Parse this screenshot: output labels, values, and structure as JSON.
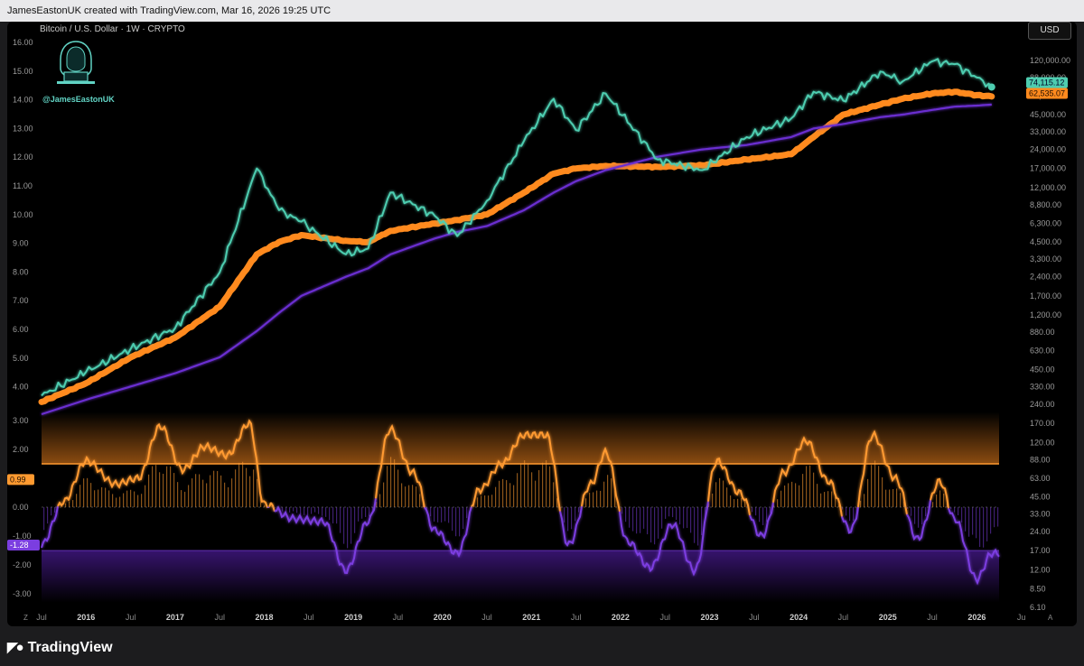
{
  "header": {
    "credit": "JamesEastonUK created with TradingView.com, Mar 16, 2026 19:25 UTC",
    "symbol": "Bitcoin / U.S. Dollar · 1W · CRYPTO",
    "handle": "@JamesEastonUK",
    "currency_button": "USD"
  },
  "footer": {
    "brand": "TradingView",
    "left_label": "Z",
    "right_label": "A"
  },
  "colors": {
    "price": "#4ecdb0",
    "orange_band": "#ff8a1e",
    "purple_ma": "#6a2ed0",
    "osc_positive": "#ff9a30",
    "osc_negative": "#7b3ee0"
  },
  "chart_data": [
    {
      "type": "line",
      "title": "Bitcoin / U.S. Dollar · 1W · CRYPTO",
      "y_scale": "log",
      "left_axis_ticks": [
        "16.00",
        "15.00",
        "14.00",
        "13.00",
        "12.00",
        "11.00",
        "10.00",
        "9.00",
        "8.00",
        "7.00",
        "6.00",
        "5.00",
        "4.00"
      ],
      "right_axis_ticks": [
        "120,000.00",
        "88,000.00",
        "63,000.00",
        "45,000.00",
        "33,000.00",
        "24,000.00",
        "17,000.00",
        "12,000.00",
        "8,800.00",
        "6,300.00",
        "4,500.00",
        "3,300.00",
        "2,400.00",
        "1,700.00",
        "1,200.00",
        "880.00",
        "630.00",
        "450.00",
        "330.00",
        "240.00",
        "170.00",
        "120.00",
        "88.00",
        "63.00",
        "45.00",
        "33.00",
        "24.00",
        "17.00",
        "12.00",
        "8.50",
        "6.10"
      ],
      "x_ticks": [
        "Jul",
        "2016",
        "Jul",
        "2017",
        "Jul",
        "2018",
        "Jul",
        "2019",
        "Jul",
        "2020",
        "Jul",
        "2021",
        "Jul",
        "2022",
        "Jul",
        "2023",
        "Jul",
        "2024",
        "Jul",
        "2025",
        "Jul",
        "2026",
        "Ju"
      ],
      "x": [
        "2015-07",
        "2016-01",
        "2016-07",
        "2017-01",
        "2017-07",
        "2017-12",
        "2018-03",
        "2018-06",
        "2018-12",
        "2019-03",
        "2019-06",
        "2019-12",
        "2020-03",
        "2020-07",
        "2020-12",
        "2021-04",
        "2021-07",
        "2021-11",
        "2022-06",
        "2022-12",
        "2023-06",
        "2023-12",
        "2024-03",
        "2024-07",
        "2024-12",
        "2025-03",
        "2025-07",
        "2025-10",
        "2026-01",
        "2026-03"
      ],
      "series": [
        {
          "name": "",
          "role": "price",
          "values": [
            280,
            430,
            650,
            950,
            2600,
            17000,
            8000,
            6500,
            3600,
            4000,
            11000,
            7200,
            5000,
            9500,
            28000,
            60000,
            34000,
            66000,
            20000,
            16500,
            30000,
            42000,
            68000,
            58000,
            98000,
            82000,
            118000,
            112000,
            88000,
            74115.12
          ]
        },
        {
          "name": "",
          "role": "orange-band",
          "values": [
            250,
            350,
            560,
            800,
            1400,
            3600,
            4500,
            5100,
            4600,
            4500,
            5500,
            6300,
            6700,
            7400,
            11000,
            15500,
            17000,
            17800,
            17500,
            18000,
            20000,
            22000,
            30000,
            45000,
            54000,
            60000,
            66000,
            68000,
            64000,
            62535.07
          ]
        },
        {
          "name": "",
          "role": "purple-ma",
          "values": [
            200,
            260,
            330,
            420,
            560,
            900,
            1250,
            1700,
            2400,
            2800,
            3600,
            4800,
            5400,
            6000,
            8000,
            11000,
            13500,
            16500,
            21000,
            24000,
            26000,
            30000,
            35000,
            38000,
            43000,
            45000,
            49000,
            52000,
            53000,
            54000
          ]
        }
      ],
      "last_price_labels": [
        "74,115.12",
        "62,535.07"
      ]
    },
    {
      "type": "line",
      "left_axis_ticks": [
        "3.00",
        "2.00",
        "1.00",
        "0.00",
        "-1.00",
        "-2.00",
        "-3.00"
      ],
      "level_labels": [
        "0.99",
        "-1.28"
      ],
      "x": [
        "2015-07",
        "2015-10",
        "2016-01",
        "2016-05",
        "2016-08",
        "2016-11",
        "2017-02",
        "2017-05",
        "2017-08",
        "2017-11",
        "2018-01",
        "2018-05",
        "2018-09",
        "2018-12",
        "2019-03",
        "2019-06",
        "2019-09",
        "2019-12",
        "2020-03",
        "2020-06",
        "2020-09",
        "2020-12",
        "2021-03",
        "2021-06",
        "2021-09",
        "2021-11",
        "2022-02",
        "2022-05",
        "2022-08",
        "2022-11",
        "2023-02",
        "2023-05",
        "2023-08",
        "2023-11",
        "2024-02",
        "2024-05",
        "2024-08",
        "2024-11",
        "2025-02",
        "2025-05",
        "2025-08",
        "2025-10",
        "2026-01",
        "2026-03"
      ],
      "series": [
        {
          "name": "",
          "values": [
            -1.3,
            0.2,
            1.6,
            0.8,
            1.0,
            2.8,
            1.3,
            2.1,
            1.8,
            2.9,
            0.1,
            -0.4,
            -0.5,
            -2.2,
            -0.5,
            2.7,
            1.2,
            -0.8,
            -1.6,
            0.6,
            1.5,
            2.5,
            2.5,
            -1.3,
            0.8,
            1.9,
            -1.2,
            -2.1,
            -0.6,
            -2.2,
            1.6,
            0.5,
            -1.0,
            1.2,
            2.3,
            0.9,
            -0.8,
            2.5,
            1.0,
            -1.1,
            0.9,
            -0.4,
            -2.5,
            -1.6
          ]
        }
      ]
    }
  ]
}
